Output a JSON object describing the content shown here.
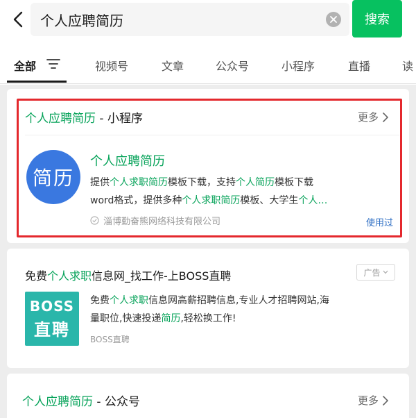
{
  "search": {
    "query": "个人应聘简历",
    "button_label": "搜索"
  },
  "tabs": [
    {
      "label": "全部"
    },
    {
      "label": "视频号"
    },
    {
      "label": "文章"
    },
    {
      "label": "公众号"
    },
    {
      "label": "小程序"
    },
    {
      "label": "直播"
    },
    {
      "label": "读"
    }
  ],
  "miniprogram_section": {
    "title_prefix": "个人应聘简历",
    "title_suffix": " - 小程序",
    "more_label": "更多",
    "logo_text": "简历",
    "name": "个人应聘简历",
    "desc_line1": [
      "提供",
      "个人求职简历",
      "模板下载，支持",
      "个人简历",
      "模板下载"
    ],
    "desc_line2": [
      "word格式，提供多种",
      "个人求职简历",
      "模板、大学生",
      "个人…"
    ],
    "provider": "淄博勤奋熊网络科技有限公司",
    "used_label": "使用过"
  },
  "ad": {
    "title_parts": [
      "免费",
      "个人求职",
      "信息网_找工作-上BOSS直聘"
    ],
    "badge_label": "广告",
    "logo_line1": "BOSS",
    "logo_line2": "直聘",
    "desc_line1": [
      "免费",
      "个人求职",
      "信息网高薪招聘信息,专业人才招聘网站,海"
    ],
    "desc_line2": [
      "量职位,快速投递",
      "简历",
      ",轻松换工作!"
    ],
    "brand": "BOSS直聘"
  },
  "official_section": {
    "title_prefix": "个人应聘简历",
    "title_suffix": " - 公众号",
    "more_label": "更多"
  },
  "colors": {
    "accent_green": "#07c160",
    "highlight_red": "#e4282d",
    "keyword_green": "#07a35a"
  }
}
